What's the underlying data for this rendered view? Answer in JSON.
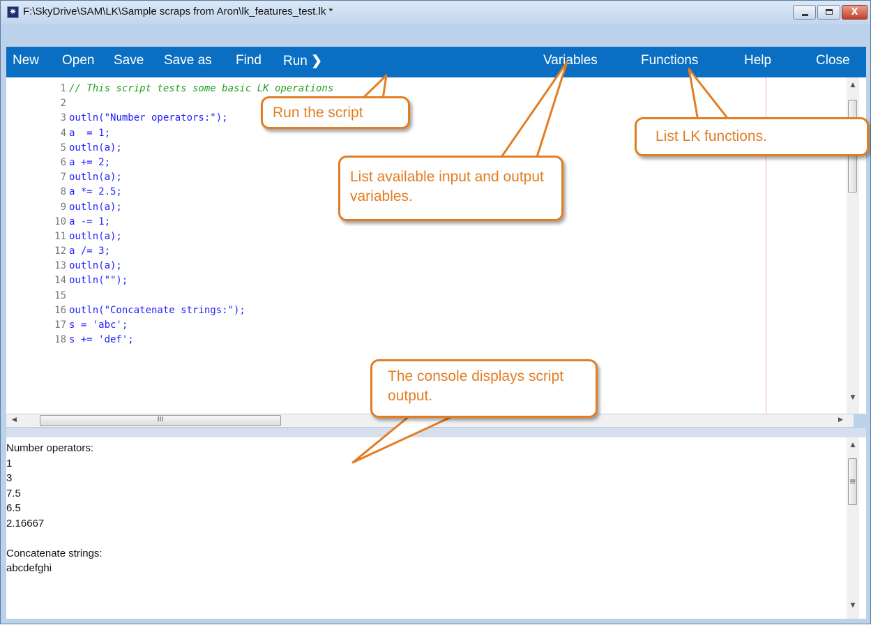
{
  "window": {
    "title": "F:\\SkyDrive\\SAM\\LK\\Sample scraps from Aron\\lk_features_test.lk *",
    "close_glyph": "X"
  },
  "toolbar": {
    "new": "New",
    "open": "Open",
    "save": "Save",
    "save_as": "Save as",
    "find": "Find",
    "run": "Run",
    "run_arrow": "❯",
    "variables": "Variables",
    "functions": "Functions",
    "help": "Help",
    "close": "Close",
    "background_color": "#0a6fc3"
  },
  "editor": {
    "line_numbers": [
      "1",
      "2",
      "3",
      "4",
      "5",
      "6",
      "7",
      "8",
      "9",
      "10",
      "11",
      "12",
      "13",
      "14",
      "15",
      "16",
      "17",
      "18"
    ],
    "lines": [
      "// This script tests some basic LK operations",
      "",
      "outln(\"Number operators:\");",
      "a  = 1;",
      "outln(a);",
      "a += 2;",
      "outln(a);",
      "a *= 2.5;",
      "outln(a);",
      "a -= 1;",
      "outln(a);",
      "a /= 3;",
      "outln(a);",
      "outln(\"\");",
      "",
      "outln(\"Concatenate strings:\");",
      "s = 'abc';",
      "s += 'def';"
    ],
    "hscroll_grip": "III"
  },
  "console": {
    "lines": [
      "Number operators:",
      "1",
      "3",
      "7.5",
      "6.5",
      "2.16667",
      "",
      "Concatenate strings:",
      "abcdefghi"
    ],
    "scroll_grip": "≡"
  },
  "callouts": {
    "run": "Run the script",
    "variables": "List available input and output variables.",
    "functions": "List LK functions.",
    "console": "The console displays script output.",
    "accent_color": "#e27d22"
  },
  "icons": {
    "app": "sun-icon",
    "scroll_up": "triangle-up-icon",
    "scroll_down": "triangle-down-icon",
    "scroll_left": "triangle-left-icon",
    "scroll_right": "triangle-right-icon"
  }
}
